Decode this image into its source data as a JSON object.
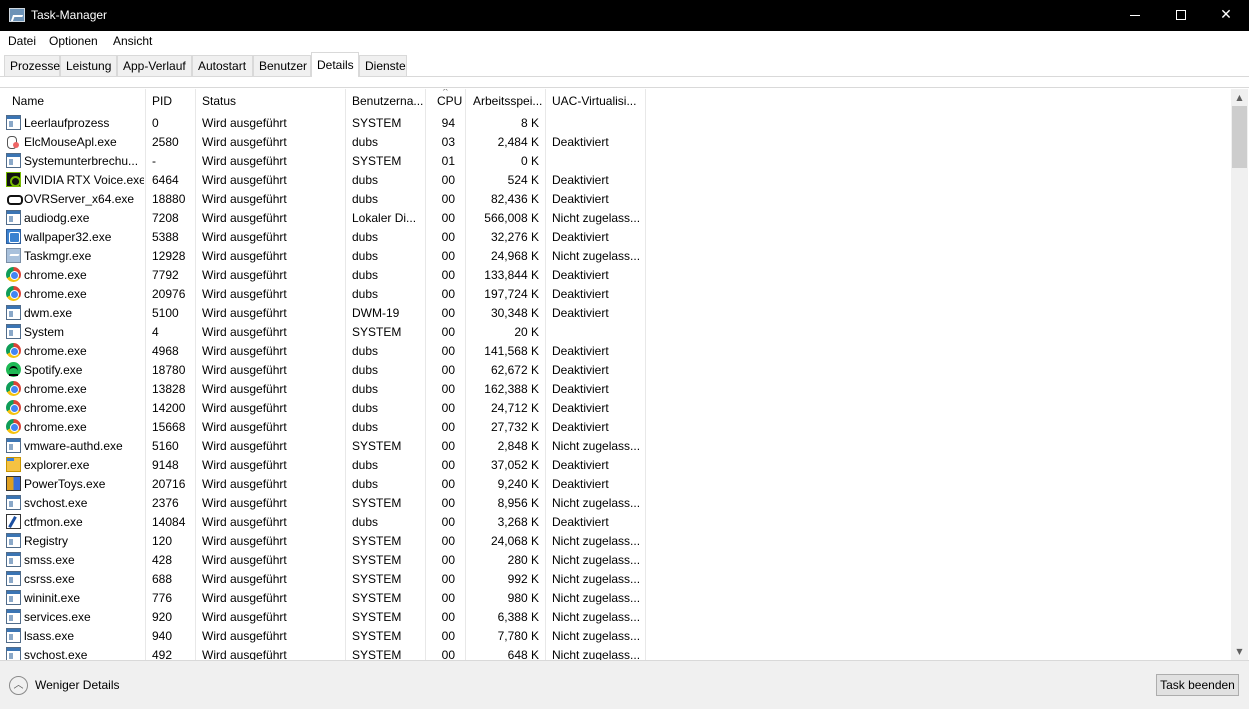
{
  "window": {
    "title": "Task-Manager",
    "minimize": "–",
    "maximize": "",
    "close": "✕"
  },
  "menu": [
    "Datei",
    "Optionen",
    "Ansicht"
  ],
  "tabs": [
    "Prozesse",
    "Leistung",
    "App-Verlauf",
    "Autostart",
    "Benutzer",
    "Details",
    "Dienste"
  ],
  "active_tab": "Details",
  "columns": {
    "name": "Name",
    "pid": "PID",
    "status": "Status",
    "user": "Benutzerna...",
    "cpu": "CPU",
    "memory": "Arbeitsspei...",
    "uac": "UAC-Virtualisi..."
  },
  "sort_indicator": "^",
  "rows": [
    {
      "name": "Leerlaufprozess",
      "pid": "0",
      "status": "Wird ausgeführt",
      "user": "SYSTEM",
      "cpu": "94",
      "memory": "8 K",
      "uac": "",
      "icon": "window-icon"
    },
    {
      "name": "ElcMouseApl.exe",
      "pid": "2580",
      "status": "Wird ausgeführt",
      "user": "dubs",
      "cpu": "03",
      "memory": "2,484 K",
      "uac": "Deaktiviert",
      "icon": "mouse-icon"
    },
    {
      "name": "Systemunterbrechu...",
      "pid": "-",
      "status": "Wird ausgeführt",
      "user": "SYSTEM",
      "cpu": "01",
      "memory": "0 K",
      "uac": "",
      "icon": "window-icon"
    },
    {
      "name": "NVIDIA RTX Voice.exe",
      "pid": "6464",
      "status": "Wird ausgeführt",
      "user": "dubs",
      "cpu": "00",
      "memory": "524 K",
      "uac": "Deaktiviert",
      "icon": "nvidia-icon"
    },
    {
      "name": "OVRServer_x64.exe",
      "pid": "18880",
      "status": "Wird ausgeführt",
      "user": "dubs",
      "cpu": "00",
      "memory": "82,436 K",
      "uac": "Deaktiviert",
      "icon": "ovr-icon"
    },
    {
      "name": "audiodg.exe",
      "pid": "7208",
      "status": "Wird ausgeführt",
      "user": "Lokaler Di...",
      "cpu": "00",
      "memory": "566,008 K",
      "uac": "Nicht zugelass...",
      "icon": "window-icon"
    },
    {
      "name": "wallpaper32.exe",
      "pid": "5388",
      "status": "Wird ausgeführt",
      "user": "dubs",
      "cpu": "00",
      "memory": "32,276 K",
      "uac": "Deaktiviert",
      "icon": "wallpaper-icon"
    },
    {
      "name": "Taskmgr.exe",
      "pid": "12928",
      "status": "Wird ausgeführt",
      "user": "dubs",
      "cpu": "00",
      "memory": "24,968 K",
      "uac": "Nicht zugelass...",
      "icon": "taskmgr-icon"
    },
    {
      "name": "chrome.exe",
      "pid": "7792",
      "status": "Wird ausgeführt",
      "user": "dubs",
      "cpu": "00",
      "memory": "133,844 K",
      "uac": "Deaktiviert",
      "icon": "chrome-icon"
    },
    {
      "name": "chrome.exe",
      "pid": "20976",
      "status": "Wird ausgeführt",
      "user": "dubs",
      "cpu": "00",
      "memory": "197,724 K",
      "uac": "Deaktiviert",
      "icon": "chrome-icon"
    },
    {
      "name": "dwm.exe",
      "pid": "5100",
      "status": "Wird ausgeführt",
      "user": "DWM-19",
      "cpu": "00",
      "memory": "30,348 K",
      "uac": "Deaktiviert",
      "icon": "window-icon"
    },
    {
      "name": "System",
      "pid": "4",
      "status": "Wird ausgeführt",
      "user": "SYSTEM",
      "cpu": "00",
      "memory": "20 K",
      "uac": "",
      "icon": "window-icon"
    },
    {
      "name": "chrome.exe",
      "pid": "4968",
      "status": "Wird ausgeführt",
      "user": "dubs",
      "cpu": "00",
      "memory": "141,568 K",
      "uac": "Deaktiviert",
      "icon": "chrome-icon"
    },
    {
      "name": "Spotify.exe",
      "pid": "18780",
      "status": "Wird ausgeführt",
      "user": "dubs",
      "cpu": "00",
      "memory": "62,672 K",
      "uac": "Deaktiviert",
      "icon": "spotify-icon"
    },
    {
      "name": "chrome.exe",
      "pid": "13828",
      "status": "Wird ausgeführt",
      "user": "dubs",
      "cpu": "00",
      "memory": "162,388 K",
      "uac": "Deaktiviert",
      "icon": "chrome-icon"
    },
    {
      "name": "chrome.exe",
      "pid": "14200",
      "status": "Wird ausgeführt",
      "user": "dubs",
      "cpu": "00",
      "memory": "24,712 K",
      "uac": "Deaktiviert",
      "icon": "chrome-icon"
    },
    {
      "name": "chrome.exe",
      "pid": "15668",
      "status": "Wird ausgeführt",
      "user": "dubs",
      "cpu": "00",
      "memory": "27,732 K",
      "uac": "Deaktiviert",
      "icon": "chrome-icon"
    },
    {
      "name": "vmware-authd.exe",
      "pid": "5160",
      "status": "Wird ausgeführt",
      "user": "SYSTEM",
      "cpu": "00",
      "memory": "2,848 K",
      "uac": "Nicht zugelass...",
      "icon": "window-icon"
    },
    {
      "name": "explorer.exe",
      "pid": "9148",
      "status": "Wird ausgeführt",
      "user": "dubs",
      "cpu": "00",
      "memory": "37,052 K",
      "uac": "Deaktiviert",
      "icon": "explorer-icon"
    },
    {
      "name": "PowerToys.exe",
      "pid": "20716",
      "status": "Wird ausgeführt",
      "user": "dubs",
      "cpu": "00",
      "memory": "9,240 K",
      "uac": "Deaktiviert",
      "icon": "powertoys-icon"
    },
    {
      "name": "svchost.exe",
      "pid": "2376",
      "status": "Wird ausgeführt",
      "user": "SYSTEM",
      "cpu": "00",
      "memory": "8,956 K",
      "uac": "Nicht zugelass...",
      "icon": "window-icon"
    },
    {
      "name": "ctfmon.exe",
      "pid": "14084",
      "status": "Wird ausgeführt",
      "user": "dubs",
      "cpu": "00",
      "memory": "3,268 K",
      "uac": "Deaktiviert",
      "icon": "ctfmon-icon"
    },
    {
      "name": "Registry",
      "pid": "120",
      "status": "Wird ausgeführt",
      "user": "SYSTEM",
      "cpu": "00",
      "memory": "24,068 K",
      "uac": "Nicht zugelass...",
      "icon": "window-icon"
    },
    {
      "name": "smss.exe",
      "pid": "428",
      "status": "Wird ausgeführt",
      "user": "SYSTEM",
      "cpu": "00",
      "memory": "280 K",
      "uac": "Nicht zugelass...",
      "icon": "window-icon"
    },
    {
      "name": "csrss.exe",
      "pid": "688",
      "status": "Wird ausgeführt",
      "user": "SYSTEM",
      "cpu": "00",
      "memory": "992 K",
      "uac": "Nicht zugelass...",
      "icon": "window-icon"
    },
    {
      "name": "wininit.exe",
      "pid": "776",
      "status": "Wird ausgeführt",
      "user": "SYSTEM",
      "cpu": "00",
      "memory": "980 K",
      "uac": "Nicht zugelass...",
      "icon": "window-icon"
    },
    {
      "name": "services.exe",
      "pid": "920",
      "status": "Wird ausgeführt",
      "user": "SYSTEM",
      "cpu": "00",
      "memory": "6,388 K",
      "uac": "Nicht zugelass...",
      "icon": "window-icon"
    },
    {
      "name": "lsass.exe",
      "pid": "940",
      "status": "Wird ausgeführt",
      "user": "SYSTEM",
      "cpu": "00",
      "memory": "7,780 K",
      "uac": "Nicht zugelass...",
      "icon": "window-icon"
    },
    {
      "name": "svchost.exe",
      "pid": "492",
      "status": "Wird ausgeführt",
      "user": "SYSTEM",
      "cpu": "00",
      "memory": "648 K",
      "uac": "Nicht zugelass...",
      "icon": "window-icon"
    }
  ],
  "footer": {
    "fewer_details": "Weniger Details",
    "end_task": "Task beenden"
  },
  "colors": {
    "titlebar": "#000000",
    "chrome_bg": "#f0f0f0",
    "border": "#d9d9d9"
  }
}
